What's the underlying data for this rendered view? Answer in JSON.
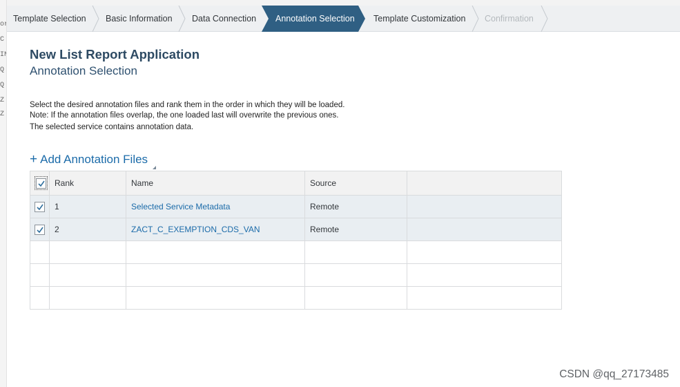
{
  "wizard": {
    "steps": [
      {
        "label": "Template Selection",
        "state": "done"
      },
      {
        "label": "Basic Information",
        "state": "done"
      },
      {
        "label": "Data Connection",
        "state": "done"
      },
      {
        "label": "Annotation Selection",
        "state": "active"
      },
      {
        "label": "Template Customization",
        "state": "pending"
      },
      {
        "label": "Confirmation",
        "state": "disabled"
      }
    ]
  },
  "header": {
    "title": "New List Report Application",
    "subtitle": "Annotation Selection"
  },
  "description": {
    "line1": "Select the desired annotation files and rank them in the order in which they will be loaded.",
    "line2": "Note: If the annotation files overlap, the one loaded last will overwrite the previous ones.",
    "line3": "The selected service contains annotation data."
  },
  "add_files": {
    "plus": "+",
    "label": "Add Annotation Files"
  },
  "table": {
    "columns": [
      "Rank",
      "Name",
      "Source",
      ""
    ],
    "header_checked": true,
    "rows": [
      {
        "checked": true,
        "rank": "1",
        "name": "Selected Service Metadata",
        "source": "Remote"
      },
      {
        "checked": true,
        "rank": "2",
        "name": "ZACT_C_EXEMPTION_CDS_VAN",
        "source": "Remote"
      }
    ]
  },
  "watermark": "CSDN @qq_27173485",
  "colors": {
    "active_step": "#2f5f83",
    "link": "#1b6ba9",
    "title": "#2d4a63"
  },
  "icons": {
    "checkbox": "check-icon",
    "step_separator": "chevron-right-icon"
  }
}
